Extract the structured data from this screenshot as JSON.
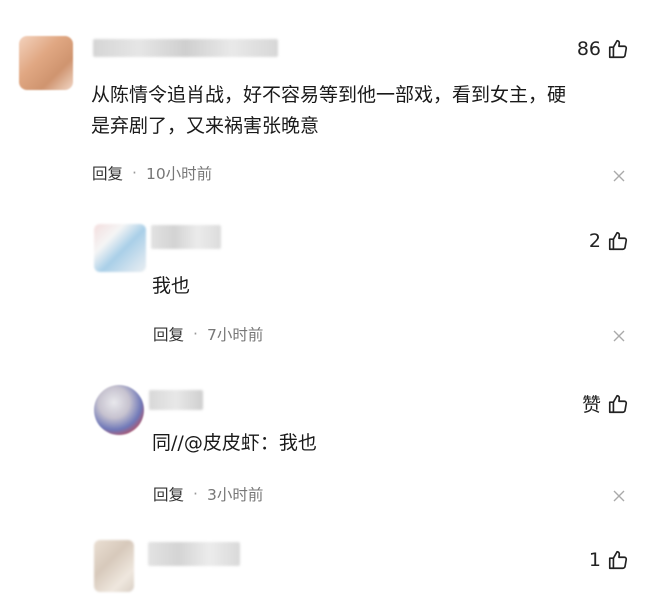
{
  "comments": [
    {
      "likes": "86",
      "text_line1": "从陈情令追肖战，好不容易等到他一部戏，看到女主，硬",
      "text_line2": "是弃剧了，又来祸害张晚意",
      "reply_label": "回复",
      "separator": "·",
      "time": "10小时前"
    },
    {
      "likes": "2",
      "text": "我也",
      "reply_label": "回复",
      "separator": "·",
      "time": "7小时前"
    },
    {
      "likes": "赞",
      "text_prefix": "同//",
      "mention": "@皮皮虾",
      "text_suffix": "：我也",
      "reply_label": "回复",
      "separator": "·",
      "time": "3小时前"
    },
    {
      "likes": "1"
    }
  ],
  "icons": {
    "like": "thumbs-up-icon",
    "dismiss": "close-icon"
  },
  "colors": {
    "mention": "#3b5a8c",
    "meta_text": "#777777",
    "main_text": "#1a1a1a"
  }
}
